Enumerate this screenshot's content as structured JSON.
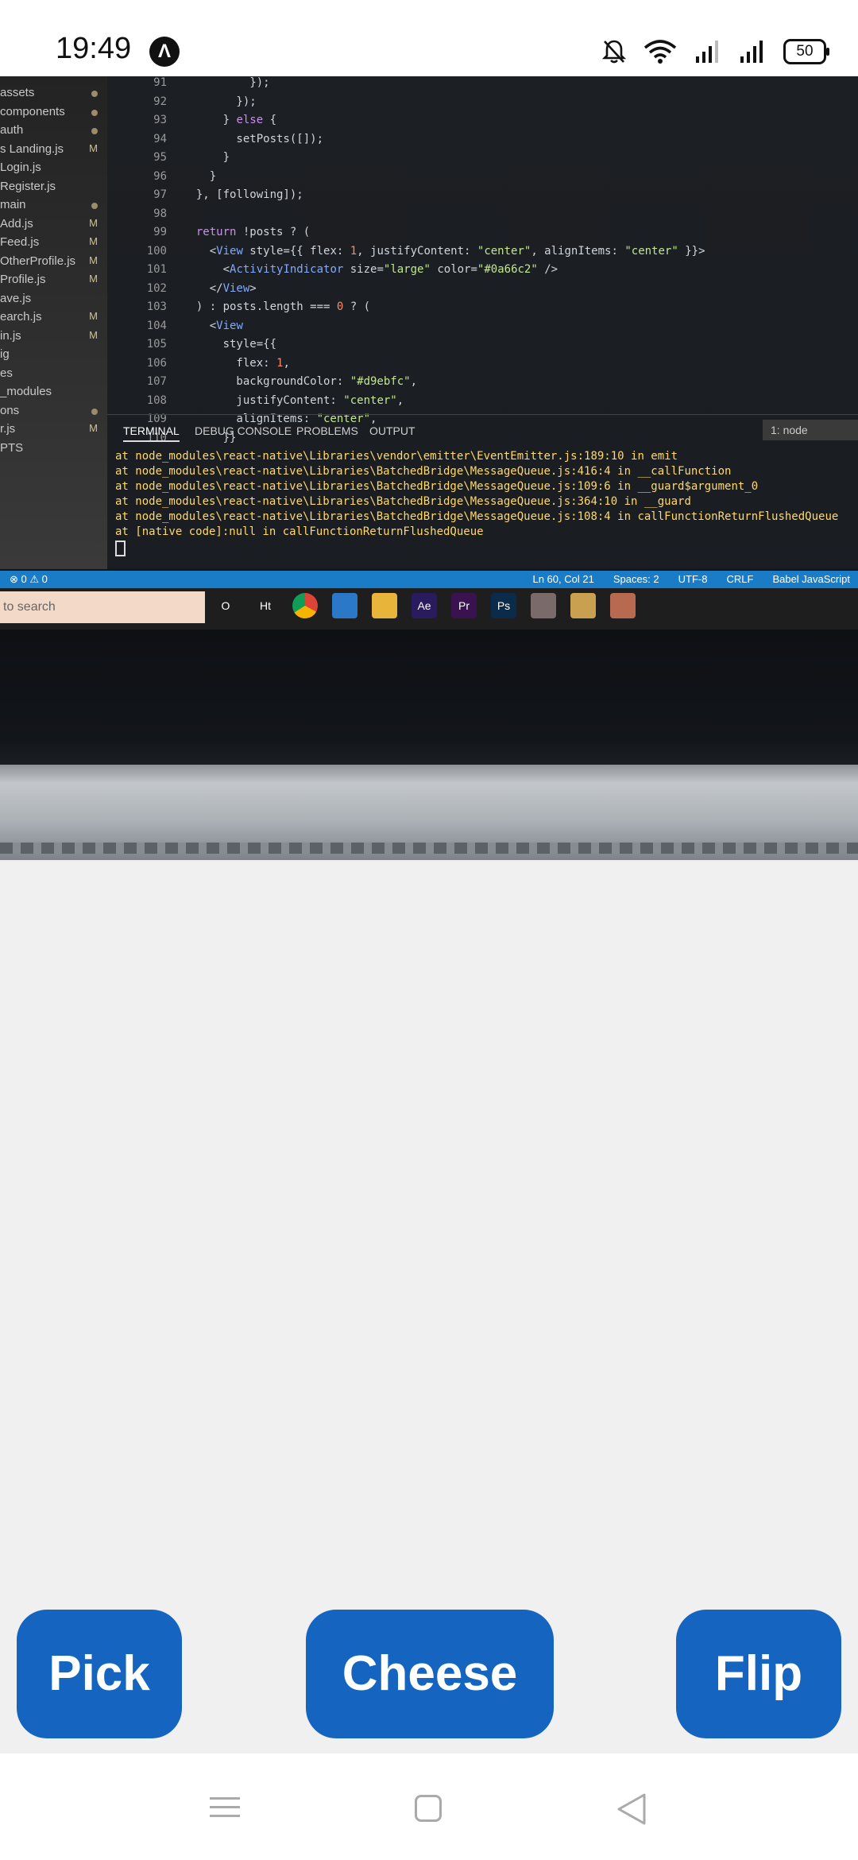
{
  "status_bar": {
    "time": "19:49",
    "app_badge": "Λ",
    "battery": "50",
    "icons": [
      "mute-bell-icon",
      "wifi-icon",
      "signal-icon",
      "signal-icon"
    ]
  },
  "preview": {
    "explorer": [
      {
        "name": "assets",
        "mark": "dot"
      },
      {
        "name": "components",
        "mark": "dot"
      },
      {
        "name": "auth",
        "mark": "dot"
      },
      {
        "name": "s Landing.js",
        "mark": "M"
      },
      {
        "name": "Login.js",
        "mark": ""
      },
      {
        "name": "Register.js",
        "mark": ""
      },
      {
        "name": "main",
        "mark": "dot"
      },
      {
        "name": "Add.js",
        "mark": "M"
      },
      {
        "name": "Feed.js",
        "mark": "M"
      },
      {
        "name": "OtherProfile.js",
        "mark": "M"
      },
      {
        "name": "Profile.js",
        "mark": "M"
      },
      {
        "name": "ave.js",
        "mark": ""
      },
      {
        "name": "earch.js",
        "mark": "M"
      },
      {
        "name": "in.js",
        "mark": "M"
      },
      {
        "name": "ig",
        "mark": ""
      },
      {
        "name": "es",
        "mark": ""
      },
      {
        "name": "_modules",
        "mark": ""
      },
      {
        "name": "ons",
        "mark": "dot"
      },
      {
        "name": "r.js",
        "mark": "M"
      },
      {
        "name": "PTS",
        "mark": ""
      }
    ],
    "line_numbers": [
      "91",
      "92",
      "93",
      "94",
      "95",
      "96",
      "97",
      "98",
      "99",
      "100",
      "101",
      "102",
      "103",
      "104",
      "105",
      "106",
      "107",
      "108",
      "109",
      "110"
    ],
    "code_lines": [
      "          });",
      "        });",
      "      } else {",
      "        setPosts([]);",
      "      }",
      "    }",
      "  }, [following]);",
      "",
      "  return !posts ? (",
      "    <View style={{ flex: 1, justifyContent: \"center\", alignItems: \"center\" }}>",
      "      <ActivityIndicator size=\"large\" color=\"#0a66c2\" />",
      "    </View>",
      "  ) : posts.length === 0 ? (",
      "    <View",
      "      style={{",
      "        flex: 1,",
      "        backgroundColor: \"#d9ebfc\",",
      "        justifyContent: \"center\",",
      "        alignItems: \"center\",",
      "      }}"
    ],
    "panel_tabs": [
      "TERMINAL",
      "DEBUG CONSOLE",
      "PROBLEMS",
      "OUTPUT"
    ],
    "node_select": "1: node",
    "terminal_lines": [
      "at node_modules\\react-native\\Libraries\\vendor\\emitter\\EventEmitter.js:189:10 in emit",
      "at node_modules\\react-native\\Libraries\\BatchedBridge\\MessageQueue.js:416:4 in __callFunction",
      "at node_modules\\react-native\\Libraries\\BatchedBridge\\MessageQueue.js:109:6 in __guard$argument_0",
      "at node_modules\\react-native\\Libraries\\BatchedBridge\\MessageQueue.js:364:10 in __guard",
      "at node_modules\\react-native\\Libraries\\BatchedBridge\\MessageQueue.js:108:4 in callFunctionReturnFlushedQueue",
      "at [native code]:null in callFunctionReturnFlushedQueue"
    ],
    "status_left": "⊗ 0 ⚠ 0",
    "status_right": [
      "Ln 60, Col 21",
      "Spaces: 2",
      "UTF-8",
      "CRLF",
      "Babel JavaScript"
    ],
    "taskbar_search": "to search",
    "taskbar_icons": [
      "O",
      "Ht",
      "",
      "",
      "",
      "Ae",
      "Pr",
      "Ps",
      "",
      "",
      ""
    ]
  },
  "buttons": {
    "pick": "Pick",
    "cheese": "Cheese",
    "flip": "Flip"
  },
  "colors": {
    "accent": "#1565c0",
    "background": "#f0f0f0"
  }
}
